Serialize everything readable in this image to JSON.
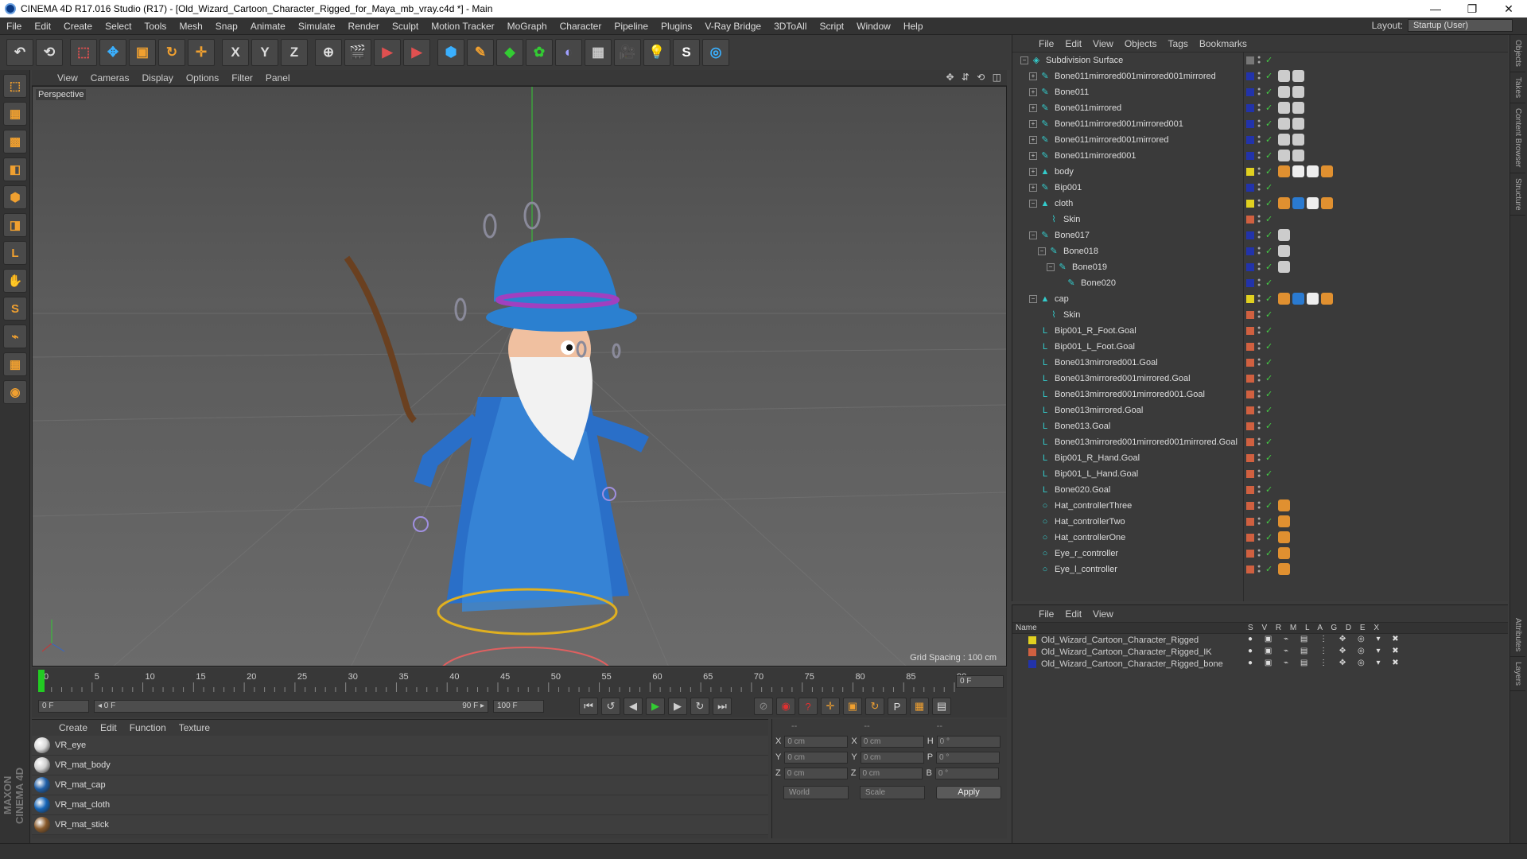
{
  "window": {
    "title": "CINEMA 4D R17.016 Studio (R17) - [Old_Wizard_Cartoon_Character_Rigged_for_Maya_mb_vray.c4d *] - Main",
    "minimize": "—",
    "maximize": "❐",
    "close": "✕"
  },
  "menu": [
    "File",
    "Edit",
    "Create",
    "Select",
    "Tools",
    "Mesh",
    "Snap",
    "Animate",
    "Simulate",
    "Render",
    "Sculpt",
    "Motion Tracker",
    "MoGraph",
    "Character",
    "Pipeline",
    "Plugins",
    "V-Ray Bridge",
    "3DToAll",
    "Script",
    "Window",
    "Help"
  ],
  "layout": {
    "label": "Layout:",
    "value": "Startup (User)"
  },
  "toolbar": [
    "↶",
    "⟲",
    "⬚",
    "✥",
    "▣",
    "↻",
    "✛",
    "X",
    "Y",
    "Z",
    "⊕",
    "🎬",
    "▶",
    "▶",
    "⬢",
    "✎",
    "◆",
    "✿",
    "◐",
    "▦",
    "🎥",
    "💡",
    "S",
    "◎"
  ],
  "left_tools": [
    "⬚",
    "▦",
    "▩",
    "◧",
    "⬢",
    "◨",
    "L",
    "✋",
    "S",
    "⌁",
    "▦",
    "◉"
  ],
  "viewport": {
    "menu": [
      "View",
      "Cameras",
      "Display",
      "Options",
      "Filter",
      "Panel"
    ],
    "nav": "✥ ⇵ ⟲ ◫",
    "label": "Perspective",
    "grid_spacing": "Grid Spacing : 100 cm"
  },
  "timeline": {
    "ticks": [
      "0",
      "5",
      "10",
      "15",
      "20",
      "25",
      "30",
      "35",
      "40",
      "45",
      "50",
      "55",
      "60",
      "65",
      "70",
      "75",
      "80",
      "85",
      "90"
    ],
    "current_frame_box": "0 F",
    "start": "0 F",
    "range_start": "◂ 0 F",
    "range_end": "90 F ▸",
    "end": "100 F",
    "transport": [
      "⏮",
      "↺",
      "◀",
      "▶",
      "▶",
      "↻",
      "⏭"
    ],
    "keys": [
      "⊘",
      "◉",
      "?",
      "✛",
      "▣",
      "↻",
      "P",
      "▦",
      "▤"
    ]
  },
  "materials": {
    "menu": [
      "Create",
      "Edit",
      "Function",
      "Texture"
    ],
    "items": [
      {
        "name": "VR_eye",
        "color": "#d8d8d8"
      },
      {
        "name": "VR_mat_body",
        "color": "#cfcfcf"
      },
      {
        "name": "VR_mat_cap",
        "color": "#1f5fa8"
      },
      {
        "name": "VR_mat_cloth",
        "color": "#1565b8"
      },
      {
        "name": "VR_mat_stick",
        "color": "#8a5a2a"
      }
    ]
  },
  "coords": {
    "header": [
      "--",
      "--",
      "--"
    ],
    "rows": [
      {
        "a": "X",
        "av": "0 cm",
        "b": "X",
        "bv": "0 cm",
        "c": "H",
        "cv": "0 °"
      },
      {
        "a": "Y",
        "av": "0 cm",
        "b": "Y",
        "bv": "0 cm",
        "c": "P",
        "cv": "0 °"
      },
      {
        "a": "Z",
        "av": "0 cm",
        "b": "Z",
        "bv": "0 cm",
        "c": "B",
        "cv": "0 °"
      }
    ],
    "world": "World",
    "scale": "Scale",
    "apply": "Apply"
  },
  "objects": {
    "menu": [
      "File",
      "Edit",
      "View",
      "Objects",
      "Tags",
      "Bookmarks"
    ],
    "items": [
      {
        "name": "Subdivision Surface",
        "depth": 0,
        "exp": "−",
        "icon": "◈",
        "layer": "#777",
        "tags": []
      },
      {
        "name": "Bone011mirrored001mirrored001mirrored",
        "depth": 1,
        "exp": "+",
        "icon": "✎",
        "layer": "#2233aa",
        "tags": [
          "#ccc",
          "#ccc"
        ]
      },
      {
        "name": "Bone011",
        "depth": 1,
        "exp": "+",
        "icon": "✎",
        "layer": "#2233aa",
        "tags": [
          "#ccc",
          "#ccc"
        ]
      },
      {
        "name": "Bone011mirrored",
        "depth": 1,
        "exp": "+",
        "icon": "✎",
        "layer": "#2233aa",
        "tags": [
          "#ccc",
          "#ccc"
        ]
      },
      {
        "name": "Bone011mirrored001mirrored001",
        "depth": 1,
        "exp": "+",
        "icon": "✎",
        "layer": "#2233aa",
        "tags": [
          "#ccc",
          "#ccc"
        ]
      },
      {
        "name": "Bone011mirrored001mirrored",
        "depth": 1,
        "exp": "+",
        "icon": "✎",
        "layer": "#2233aa",
        "tags": [
          "#ccc",
          "#ccc"
        ]
      },
      {
        "name": "Bone011mirrored001",
        "depth": 1,
        "exp": "+",
        "icon": "✎",
        "layer": "#2233aa",
        "tags": [
          "#ccc",
          "#ccc"
        ]
      },
      {
        "name": "body",
        "depth": 1,
        "exp": "+",
        "icon": "▲",
        "layer": "#e0d020",
        "tags": [
          "#e09030",
          "#eee",
          "#eee",
          "#e09030"
        ]
      },
      {
        "name": "Bip001",
        "depth": 1,
        "exp": "+",
        "icon": "✎",
        "layer": "#2233aa",
        "tags": []
      },
      {
        "name": "cloth",
        "depth": 1,
        "exp": "−",
        "icon": "▲",
        "layer": "#e0d020",
        "tags": [
          "#e09030",
          "#2a7ad0",
          "#eee",
          "#e09030"
        ]
      },
      {
        "name": "Skin",
        "depth": 2,
        "exp": "",
        "icon": "⌇",
        "layer": "#d06040",
        "tags": []
      },
      {
        "name": "Bone017",
        "depth": 1,
        "exp": "−",
        "icon": "✎",
        "layer": "#2233aa",
        "tags": [
          "#ccc"
        ]
      },
      {
        "name": "Bone018",
        "depth": 2,
        "exp": "−",
        "icon": "✎",
        "layer": "#2233aa",
        "tags": [
          "#ccc"
        ]
      },
      {
        "name": "Bone019",
        "depth": 3,
        "exp": "−",
        "icon": "✎",
        "layer": "#2233aa",
        "tags": [
          "#ccc"
        ]
      },
      {
        "name": "Bone020",
        "depth": 4,
        "exp": "",
        "icon": "✎",
        "layer": "#2233aa",
        "tags": []
      },
      {
        "name": "cap",
        "depth": 1,
        "exp": "−",
        "icon": "▲",
        "layer": "#e0d020",
        "tags": [
          "#e09030",
          "#2a7ad0",
          "#eee",
          "#e09030"
        ]
      },
      {
        "name": "Skin",
        "depth": 2,
        "exp": "",
        "icon": "⌇",
        "layer": "#d06040",
        "tags": []
      },
      {
        "name": "Bip001_R_Foot.Goal",
        "depth": 1,
        "exp": "",
        "icon": "L",
        "layer": "#d06040",
        "tags": []
      },
      {
        "name": "Bip001_L_Foot.Goal",
        "depth": 1,
        "exp": "",
        "icon": "L",
        "layer": "#d06040",
        "tags": []
      },
      {
        "name": "Bone013mirrored001.Goal",
        "depth": 1,
        "exp": "",
        "icon": "L",
        "layer": "#d06040",
        "tags": []
      },
      {
        "name": "Bone013mirrored001mirrored.Goal",
        "depth": 1,
        "exp": "",
        "icon": "L",
        "layer": "#d06040",
        "tags": []
      },
      {
        "name": "Bone013mirrored001mirrored001.Goal",
        "depth": 1,
        "exp": "",
        "icon": "L",
        "layer": "#d06040",
        "tags": []
      },
      {
        "name": "Bone013mirrored.Goal",
        "depth": 1,
        "exp": "",
        "icon": "L",
        "layer": "#d06040",
        "tags": []
      },
      {
        "name": "Bone013.Goal",
        "depth": 1,
        "exp": "",
        "icon": "L",
        "layer": "#d06040",
        "tags": []
      },
      {
        "name": "Bone013mirrored001mirrored001mirrored.Goal",
        "depth": 1,
        "exp": "",
        "icon": "L",
        "layer": "#d06040",
        "tags": []
      },
      {
        "name": "Bip001_R_Hand.Goal",
        "depth": 1,
        "exp": "",
        "icon": "L",
        "layer": "#d06040",
        "tags": []
      },
      {
        "name": "Bip001_L_Hand.Goal",
        "depth": 1,
        "exp": "",
        "icon": "L",
        "layer": "#d06040",
        "tags": []
      },
      {
        "name": "Bone020.Goal",
        "depth": 1,
        "exp": "",
        "icon": "L",
        "layer": "#d06040",
        "tags": []
      },
      {
        "name": "Hat_controllerThree",
        "depth": 1,
        "exp": "",
        "icon": "○",
        "layer": "#d06040",
        "tags": [
          "#e09030"
        ]
      },
      {
        "name": "Hat_controllerTwo",
        "depth": 1,
        "exp": "",
        "icon": "○",
        "layer": "#d06040",
        "tags": [
          "#e09030"
        ]
      },
      {
        "name": "Hat_controllerOne",
        "depth": 1,
        "exp": "",
        "icon": "○",
        "layer": "#d06040",
        "tags": [
          "#e09030"
        ]
      },
      {
        "name": "Eye_r_controller",
        "depth": 1,
        "exp": "",
        "icon": "○",
        "layer": "#d06040",
        "tags": [
          "#e09030"
        ]
      },
      {
        "name": "Eye_l_controller",
        "depth": 1,
        "exp": "",
        "icon": "○",
        "layer": "#d06040",
        "tags": [
          "#e09030"
        ]
      }
    ]
  },
  "layers": {
    "menu": [
      "File",
      "Edit",
      "View"
    ],
    "header": {
      "name": "Name",
      "cols": "S V R M L A G D E X"
    },
    "items": [
      {
        "name": "Old_Wizard_Cartoon_Character_Rigged",
        "color": "#e0d020"
      },
      {
        "name": "Old_Wizard_Cartoon_Character_Rigged_IK",
        "color": "#d06040"
      },
      {
        "name": "Old_Wizard_Cartoon_Character_Rigged_bone",
        "color": "#2233aa"
      }
    ],
    "icons": "● ▣ ⌁ ▤ ⋮ ✥ ◎ ▾ ✖"
  },
  "right_tabs": [
    "Objects",
    "Takes",
    "Content Browser",
    "Structure",
    "Attributes",
    "Layers"
  ]
}
